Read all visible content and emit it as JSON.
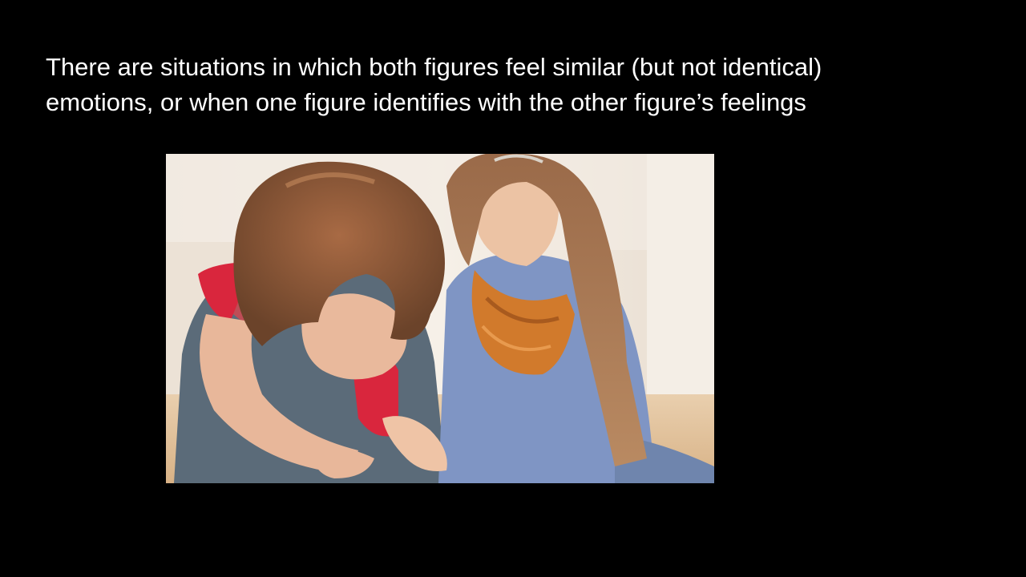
{
  "slide": {
    "background_color": "#000000",
    "text_color": "#ffffff",
    "body_lines": [
      "There are situations in which both figures feel similar (but not identical)",
      "emotions, or when one figure identifies with the other figure’s feelings"
    ]
  },
  "photo": {
    "subject": "two-women-comforting-photo",
    "colors": {
      "scarf": "#d17a2c",
      "top_left_woman": "#d9263d",
      "vest": "#5b6b79",
      "sweater": "#7f95c4",
      "hair": "#8a5a3b"
    }
  }
}
